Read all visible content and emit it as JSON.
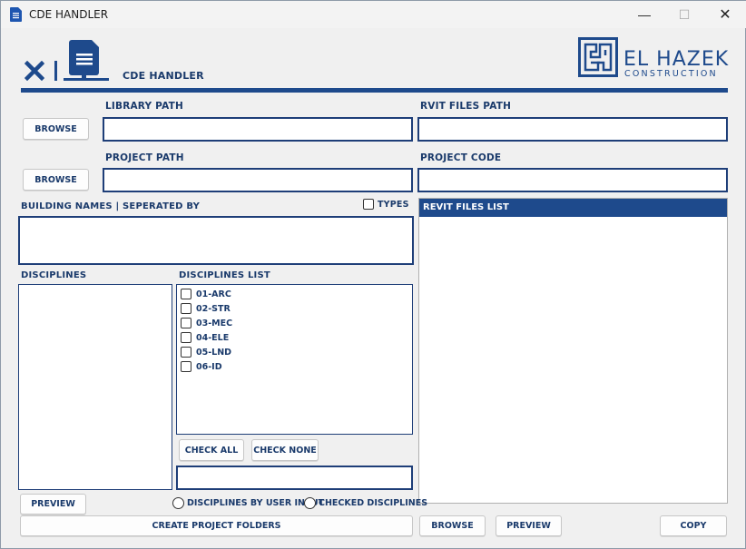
{
  "window": {
    "title": "CDE HANDLER",
    "controls": {
      "minimize": "—",
      "maximize": "☐",
      "close": "✕"
    }
  },
  "header": {
    "app_title": "CDE HANDLER",
    "brand_line1": "EL HAZEK",
    "brand_line2": "CONSTRUCTION",
    "accent_color": "#1e4a8c"
  },
  "library": {
    "label": "LIBRARY PATH",
    "browse_label": "BROWSE",
    "value": ""
  },
  "project": {
    "label": "PROJECT PATH",
    "browse_label": "BROWSE",
    "value": ""
  },
  "rvit": {
    "label": "RVIT FILES PATH",
    "value": ""
  },
  "project_code": {
    "label": "PROJECT CODE",
    "value": ""
  },
  "building": {
    "label": "BUILDING  NAMES  |  SEPERATED  BY",
    "types_label": "TYPES",
    "types_checked": false,
    "value": ""
  },
  "disciplines": {
    "label": "DISCIPLINES"
  },
  "disciplines_list": {
    "label": "DISCIPLINES LIST",
    "items": [
      {
        "label": "01-ARC",
        "checked": false
      },
      {
        "label": "02-STR",
        "checked": false
      },
      {
        "label": "03-MEC",
        "checked": false
      },
      {
        "label": "04-ELE",
        "checked": false
      },
      {
        "label": "05-LND",
        "checked": false
      },
      {
        "label": "06-ID",
        "checked": false
      }
    ],
    "check_all": "CHECK ALL",
    "check_none": "CHECK NONE"
  },
  "revit_list": {
    "header": "REVIT FILES LIST"
  },
  "bottom": {
    "preview_label": "PREVIEW",
    "radio_user_input": "DISCIPLINES BY USER INPUT",
    "radio_checked": "CHECKED DISCIPLINES",
    "create_label": "CREATE PROJECT FOLDERS",
    "browse_label": "BROWSE",
    "preview2_label": "PREVIEW",
    "copy_label": "COPY"
  }
}
